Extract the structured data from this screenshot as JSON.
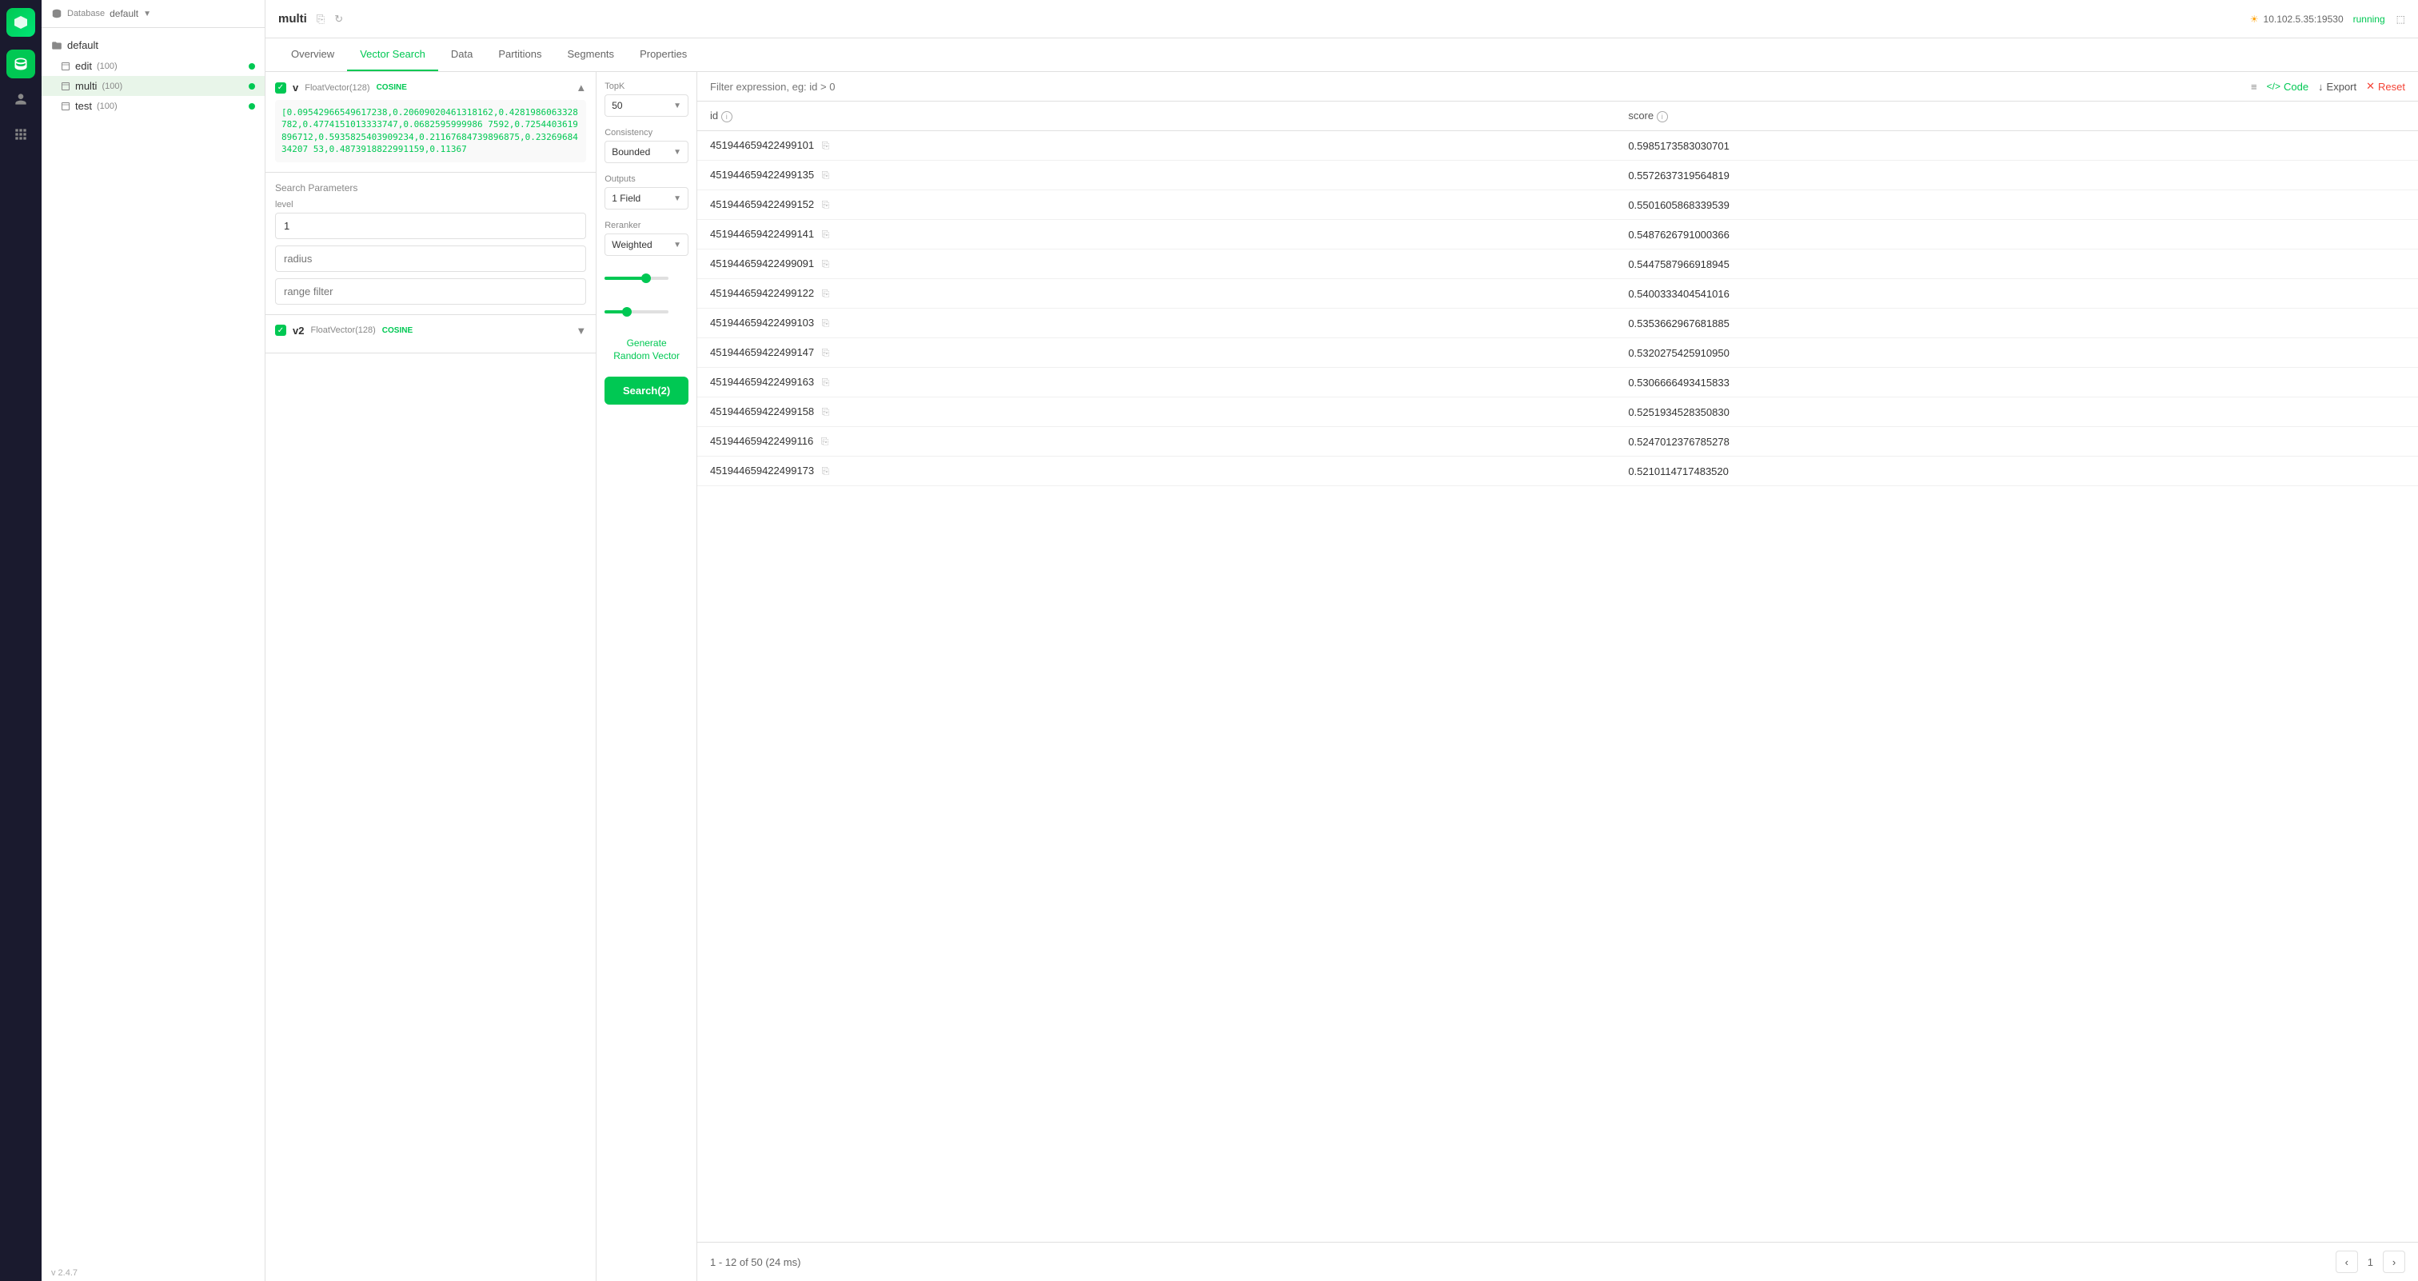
{
  "app": {
    "version": "v 2.4.7"
  },
  "topbar": {
    "database_label": "Database",
    "database_name": "default",
    "collection_name": "multi",
    "server": "10.102.5.35:19530",
    "status": "running"
  },
  "sidebar": {
    "db_name": "default",
    "items": [
      {
        "name": "edit",
        "count": "(100)"
      },
      {
        "name": "multi",
        "count": "(100)"
      },
      {
        "name": "test",
        "count": "(100)"
      }
    ]
  },
  "tabs": [
    "Overview",
    "Vector Search",
    "Data",
    "Partitions",
    "Segments",
    "Properties"
  ],
  "active_tab": "Vector Search",
  "vector_fields": [
    {
      "name": "v",
      "type": "FloatVector(128)",
      "metric": "COSINE",
      "expanded": true,
      "vector_data": "[0.09542966549617238,0.20609020461318162,0.42819860633287 82,0.47741510133337 47,0.06825959999867592,0.7254403619896712,0.59358254039092 34,0.211676847398968 75,0.23269684342075 3,0.4873918822991159,0.11367"
    },
    {
      "name": "v2",
      "type": "FloatVector(128)",
      "metric": "COSINE",
      "expanded": false
    }
  ],
  "search_params": {
    "level_label": "level",
    "level_value": "1",
    "radius_placeholder": "radius",
    "range_filter_placeholder": "range filter"
  },
  "topk": {
    "label": "TopK",
    "value": "50"
  },
  "consistency": {
    "label": "Consistency",
    "value": "Bounded"
  },
  "outputs": {
    "label": "Outputs",
    "value": "1 Field"
  },
  "reranker": {
    "label": "Reranker",
    "value": "Weighted"
  },
  "sliders": {
    "slider1_pct": 65,
    "slider2_pct": 35
  },
  "actions": {
    "generate_random": "Generate\nRandom Vector",
    "search_btn": "Search(2)"
  },
  "filter_placeholder": "Filter expression, eg: id > 0",
  "toolbar_actions": {
    "code": "Code",
    "export": "Export",
    "reset": "Reset"
  },
  "table": {
    "columns": [
      "id",
      "score"
    ],
    "rows": [
      {
        "id": "451944659422499101",
        "score": "0.5985173583030701"
      },
      {
        "id": "451944659422499135",
        "score": "0.5572637319564819"
      },
      {
        "id": "451944659422499152",
        "score": "0.5501605868339539"
      },
      {
        "id": "451944659422499141",
        "score": "0.5487626791000366"
      },
      {
        "id": "451944659422499091",
        "score": "0.5447587966918945"
      },
      {
        "id": "451944659422499122",
        "score": "0.5400333404541016"
      },
      {
        "id": "451944659422499103",
        "score": "0.5353662967681885"
      },
      {
        "id": "451944659422499147",
        "score": "0.5320275425910950"
      },
      {
        "id": "451944659422499163",
        "score": "0.5306666493415833"
      },
      {
        "id": "451944659422499158",
        "score": "0.5251934528350830"
      },
      {
        "id": "451944659422499116",
        "score": "0.5247012376785278"
      },
      {
        "id": "451944659422499173",
        "score": "0.5210114717483520"
      }
    ]
  },
  "pagination": {
    "info": "1 - 12  of 50 (24 ms)",
    "current_page": "1"
  }
}
